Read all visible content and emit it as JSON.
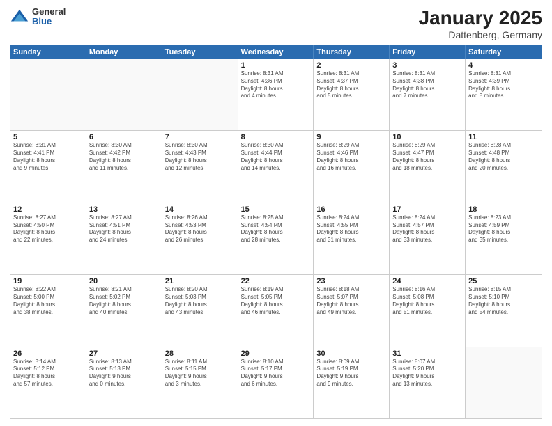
{
  "logo": {
    "general": "General",
    "blue": "Blue"
  },
  "title": "January 2025",
  "subtitle": "Dattenberg, Germany",
  "days": [
    "Sunday",
    "Monday",
    "Tuesday",
    "Wednesday",
    "Thursday",
    "Friday",
    "Saturday"
  ],
  "rows": [
    [
      {
        "day": "",
        "info": ""
      },
      {
        "day": "",
        "info": ""
      },
      {
        "day": "",
        "info": ""
      },
      {
        "day": "1",
        "info": "Sunrise: 8:31 AM\nSunset: 4:36 PM\nDaylight: 8 hours\nand 4 minutes."
      },
      {
        "day": "2",
        "info": "Sunrise: 8:31 AM\nSunset: 4:37 PM\nDaylight: 8 hours\nand 5 minutes."
      },
      {
        "day": "3",
        "info": "Sunrise: 8:31 AM\nSunset: 4:38 PM\nDaylight: 8 hours\nand 7 minutes."
      },
      {
        "day": "4",
        "info": "Sunrise: 8:31 AM\nSunset: 4:39 PM\nDaylight: 8 hours\nand 8 minutes."
      }
    ],
    [
      {
        "day": "5",
        "info": "Sunrise: 8:31 AM\nSunset: 4:41 PM\nDaylight: 8 hours\nand 9 minutes."
      },
      {
        "day": "6",
        "info": "Sunrise: 8:30 AM\nSunset: 4:42 PM\nDaylight: 8 hours\nand 11 minutes."
      },
      {
        "day": "7",
        "info": "Sunrise: 8:30 AM\nSunset: 4:43 PM\nDaylight: 8 hours\nand 12 minutes."
      },
      {
        "day": "8",
        "info": "Sunrise: 8:30 AM\nSunset: 4:44 PM\nDaylight: 8 hours\nand 14 minutes."
      },
      {
        "day": "9",
        "info": "Sunrise: 8:29 AM\nSunset: 4:46 PM\nDaylight: 8 hours\nand 16 minutes."
      },
      {
        "day": "10",
        "info": "Sunrise: 8:29 AM\nSunset: 4:47 PM\nDaylight: 8 hours\nand 18 minutes."
      },
      {
        "day": "11",
        "info": "Sunrise: 8:28 AM\nSunset: 4:48 PM\nDaylight: 8 hours\nand 20 minutes."
      }
    ],
    [
      {
        "day": "12",
        "info": "Sunrise: 8:27 AM\nSunset: 4:50 PM\nDaylight: 8 hours\nand 22 minutes."
      },
      {
        "day": "13",
        "info": "Sunrise: 8:27 AM\nSunset: 4:51 PM\nDaylight: 8 hours\nand 24 minutes."
      },
      {
        "day": "14",
        "info": "Sunrise: 8:26 AM\nSunset: 4:53 PM\nDaylight: 8 hours\nand 26 minutes."
      },
      {
        "day": "15",
        "info": "Sunrise: 8:25 AM\nSunset: 4:54 PM\nDaylight: 8 hours\nand 28 minutes."
      },
      {
        "day": "16",
        "info": "Sunrise: 8:24 AM\nSunset: 4:55 PM\nDaylight: 8 hours\nand 31 minutes."
      },
      {
        "day": "17",
        "info": "Sunrise: 8:24 AM\nSunset: 4:57 PM\nDaylight: 8 hours\nand 33 minutes."
      },
      {
        "day": "18",
        "info": "Sunrise: 8:23 AM\nSunset: 4:59 PM\nDaylight: 8 hours\nand 35 minutes."
      }
    ],
    [
      {
        "day": "19",
        "info": "Sunrise: 8:22 AM\nSunset: 5:00 PM\nDaylight: 8 hours\nand 38 minutes."
      },
      {
        "day": "20",
        "info": "Sunrise: 8:21 AM\nSunset: 5:02 PM\nDaylight: 8 hours\nand 40 minutes."
      },
      {
        "day": "21",
        "info": "Sunrise: 8:20 AM\nSunset: 5:03 PM\nDaylight: 8 hours\nand 43 minutes."
      },
      {
        "day": "22",
        "info": "Sunrise: 8:19 AM\nSunset: 5:05 PM\nDaylight: 8 hours\nand 46 minutes."
      },
      {
        "day": "23",
        "info": "Sunrise: 8:18 AM\nSunset: 5:07 PM\nDaylight: 8 hours\nand 49 minutes."
      },
      {
        "day": "24",
        "info": "Sunrise: 8:16 AM\nSunset: 5:08 PM\nDaylight: 8 hours\nand 51 minutes."
      },
      {
        "day": "25",
        "info": "Sunrise: 8:15 AM\nSunset: 5:10 PM\nDaylight: 8 hours\nand 54 minutes."
      }
    ],
    [
      {
        "day": "26",
        "info": "Sunrise: 8:14 AM\nSunset: 5:12 PM\nDaylight: 8 hours\nand 57 minutes."
      },
      {
        "day": "27",
        "info": "Sunrise: 8:13 AM\nSunset: 5:13 PM\nDaylight: 9 hours\nand 0 minutes."
      },
      {
        "day": "28",
        "info": "Sunrise: 8:11 AM\nSunset: 5:15 PM\nDaylight: 9 hours\nand 3 minutes."
      },
      {
        "day": "29",
        "info": "Sunrise: 8:10 AM\nSunset: 5:17 PM\nDaylight: 9 hours\nand 6 minutes."
      },
      {
        "day": "30",
        "info": "Sunrise: 8:09 AM\nSunset: 5:19 PM\nDaylight: 9 hours\nand 9 minutes."
      },
      {
        "day": "31",
        "info": "Sunrise: 8:07 AM\nSunset: 5:20 PM\nDaylight: 9 hours\nand 13 minutes."
      },
      {
        "day": "",
        "info": ""
      }
    ]
  ]
}
